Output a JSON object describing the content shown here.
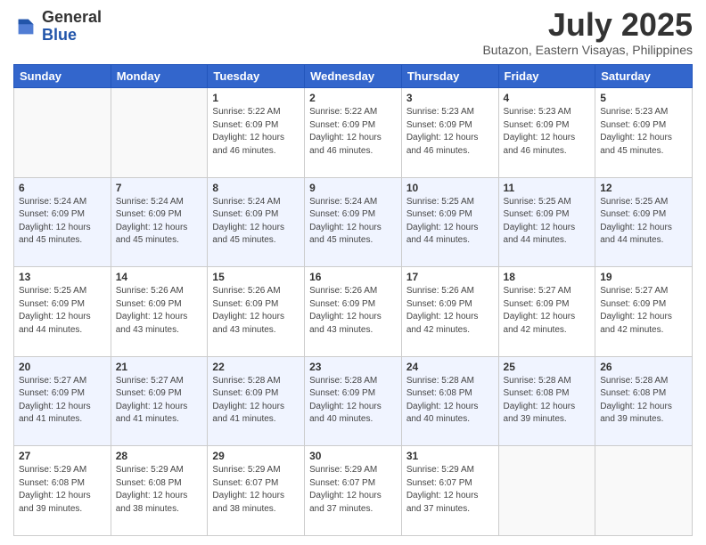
{
  "header": {
    "logo": {
      "general": "General",
      "blue": "Blue"
    },
    "month_title": "July 2025",
    "location": "Butazon, Eastern Visayas, Philippines"
  },
  "days_of_week": [
    "Sunday",
    "Monday",
    "Tuesday",
    "Wednesday",
    "Thursday",
    "Friday",
    "Saturday"
  ],
  "weeks": [
    [
      {
        "day": "",
        "sunrise": "",
        "sunset": "",
        "daylight": ""
      },
      {
        "day": "",
        "sunrise": "",
        "sunset": "",
        "daylight": ""
      },
      {
        "day": "1",
        "sunrise": "Sunrise: 5:22 AM",
        "sunset": "Sunset: 6:09 PM",
        "daylight": "Daylight: 12 hours and 46 minutes."
      },
      {
        "day": "2",
        "sunrise": "Sunrise: 5:22 AM",
        "sunset": "Sunset: 6:09 PM",
        "daylight": "Daylight: 12 hours and 46 minutes."
      },
      {
        "day": "3",
        "sunrise": "Sunrise: 5:23 AM",
        "sunset": "Sunset: 6:09 PM",
        "daylight": "Daylight: 12 hours and 46 minutes."
      },
      {
        "day": "4",
        "sunrise": "Sunrise: 5:23 AM",
        "sunset": "Sunset: 6:09 PM",
        "daylight": "Daylight: 12 hours and 46 minutes."
      },
      {
        "day": "5",
        "sunrise": "Sunrise: 5:23 AM",
        "sunset": "Sunset: 6:09 PM",
        "daylight": "Daylight: 12 hours and 45 minutes."
      }
    ],
    [
      {
        "day": "6",
        "sunrise": "Sunrise: 5:24 AM",
        "sunset": "Sunset: 6:09 PM",
        "daylight": "Daylight: 12 hours and 45 minutes."
      },
      {
        "day": "7",
        "sunrise": "Sunrise: 5:24 AM",
        "sunset": "Sunset: 6:09 PM",
        "daylight": "Daylight: 12 hours and 45 minutes."
      },
      {
        "day": "8",
        "sunrise": "Sunrise: 5:24 AM",
        "sunset": "Sunset: 6:09 PM",
        "daylight": "Daylight: 12 hours and 45 minutes."
      },
      {
        "day": "9",
        "sunrise": "Sunrise: 5:24 AM",
        "sunset": "Sunset: 6:09 PM",
        "daylight": "Daylight: 12 hours and 45 minutes."
      },
      {
        "day": "10",
        "sunrise": "Sunrise: 5:25 AM",
        "sunset": "Sunset: 6:09 PM",
        "daylight": "Daylight: 12 hours and 44 minutes."
      },
      {
        "day": "11",
        "sunrise": "Sunrise: 5:25 AM",
        "sunset": "Sunset: 6:09 PM",
        "daylight": "Daylight: 12 hours and 44 minutes."
      },
      {
        "day": "12",
        "sunrise": "Sunrise: 5:25 AM",
        "sunset": "Sunset: 6:09 PM",
        "daylight": "Daylight: 12 hours and 44 minutes."
      }
    ],
    [
      {
        "day": "13",
        "sunrise": "Sunrise: 5:25 AM",
        "sunset": "Sunset: 6:09 PM",
        "daylight": "Daylight: 12 hours and 44 minutes."
      },
      {
        "day": "14",
        "sunrise": "Sunrise: 5:26 AM",
        "sunset": "Sunset: 6:09 PM",
        "daylight": "Daylight: 12 hours and 43 minutes."
      },
      {
        "day": "15",
        "sunrise": "Sunrise: 5:26 AM",
        "sunset": "Sunset: 6:09 PM",
        "daylight": "Daylight: 12 hours and 43 minutes."
      },
      {
        "day": "16",
        "sunrise": "Sunrise: 5:26 AM",
        "sunset": "Sunset: 6:09 PM",
        "daylight": "Daylight: 12 hours and 43 minutes."
      },
      {
        "day": "17",
        "sunrise": "Sunrise: 5:26 AM",
        "sunset": "Sunset: 6:09 PM",
        "daylight": "Daylight: 12 hours and 42 minutes."
      },
      {
        "day": "18",
        "sunrise": "Sunrise: 5:27 AM",
        "sunset": "Sunset: 6:09 PM",
        "daylight": "Daylight: 12 hours and 42 minutes."
      },
      {
        "day": "19",
        "sunrise": "Sunrise: 5:27 AM",
        "sunset": "Sunset: 6:09 PM",
        "daylight": "Daylight: 12 hours and 42 minutes."
      }
    ],
    [
      {
        "day": "20",
        "sunrise": "Sunrise: 5:27 AM",
        "sunset": "Sunset: 6:09 PM",
        "daylight": "Daylight: 12 hours and 41 minutes."
      },
      {
        "day": "21",
        "sunrise": "Sunrise: 5:27 AM",
        "sunset": "Sunset: 6:09 PM",
        "daylight": "Daylight: 12 hours and 41 minutes."
      },
      {
        "day": "22",
        "sunrise": "Sunrise: 5:28 AM",
        "sunset": "Sunset: 6:09 PM",
        "daylight": "Daylight: 12 hours and 41 minutes."
      },
      {
        "day": "23",
        "sunrise": "Sunrise: 5:28 AM",
        "sunset": "Sunset: 6:09 PM",
        "daylight": "Daylight: 12 hours and 40 minutes."
      },
      {
        "day": "24",
        "sunrise": "Sunrise: 5:28 AM",
        "sunset": "Sunset: 6:08 PM",
        "daylight": "Daylight: 12 hours and 40 minutes."
      },
      {
        "day": "25",
        "sunrise": "Sunrise: 5:28 AM",
        "sunset": "Sunset: 6:08 PM",
        "daylight": "Daylight: 12 hours and 39 minutes."
      },
      {
        "day": "26",
        "sunrise": "Sunrise: 5:28 AM",
        "sunset": "Sunset: 6:08 PM",
        "daylight": "Daylight: 12 hours and 39 minutes."
      }
    ],
    [
      {
        "day": "27",
        "sunrise": "Sunrise: 5:29 AM",
        "sunset": "Sunset: 6:08 PM",
        "daylight": "Daylight: 12 hours and 39 minutes."
      },
      {
        "day": "28",
        "sunrise": "Sunrise: 5:29 AM",
        "sunset": "Sunset: 6:08 PM",
        "daylight": "Daylight: 12 hours and 38 minutes."
      },
      {
        "day": "29",
        "sunrise": "Sunrise: 5:29 AM",
        "sunset": "Sunset: 6:07 PM",
        "daylight": "Daylight: 12 hours and 38 minutes."
      },
      {
        "day": "30",
        "sunrise": "Sunrise: 5:29 AM",
        "sunset": "Sunset: 6:07 PM",
        "daylight": "Daylight: 12 hours and 37 minutes."
      },
      {
        "day": "31",
        "sunrise": "Sunrise: 5:29 AM",
        "sunset": "Sunset: 6:07 PM",
        "daylight": "Daylight: 12 hours and 37 minutes."
      },
      {
        "day": "",
        "sunrise": "",
        "sunset": "",
        "daylight": ""
      },
      {
        "day": "",
        "sunrise": "",
        "sunset": "",
        "daylight": ""
      }
    ]
  ]
}
